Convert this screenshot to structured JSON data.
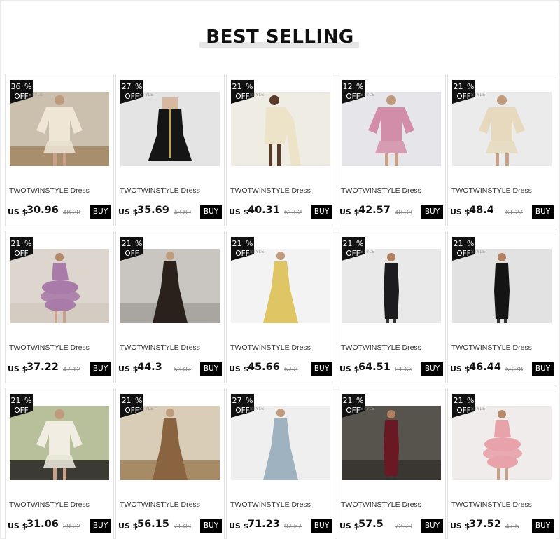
{
  "section_title": "BEST SELLING",
  "store_tag": "STYLE",
  "colors": {
    "badge": "#111111",
    "buy_button": "#000000",
    "accent_bar": "#e6e6e6"
  },
  "products": [
    {
      "discount": "36 %",
      "off": "OFF",
      "name": "TWOTWINSTYLE Dress",
      "currency": "US $",
      "price": "30.96",
      "original_price": "48.38",
      "buy": "BUY"
    },
    {
      "discount": "27 %",
      "off": "OFF",
      "name": "TWOTWINSTYLE Dress",
      "currency": "US $",
      "price": "35.69",
      "original_price": "48.89",
      "buy": "BUY"
    },
    {
      "discount": "21 %",
      "off": "OFF",
      "name": "TWOTWINSTYLE Dress",
      "currency": "US $",
      "price": "40.31",
      "original_price": "51.02",
      "buy": "BUY"
    },
    {
      "discount": "12 %",
      "off": "OFF",
      "name": "TWOTWINSTYLE Dress",
      "currency": "US $",
      "price": "42.57",
      "original_price": "48.38",
      "buy": "BUY"
    },
    {
      "discount": "21 %",
      "off": "OFF",
      "name": "TWOTWINSTYLE Dress",
      "currency": "US $",
      "price": "48.4",
      "original_price": "61.27",
      "buy": "BUY"
    },
    {
      "discount": "21 %",
      "off": "OFF",
      "name": "TWOTWINSTYLE Dress",
      "currency": "US $",
      "price": "37.22",
      "original_price": "47.12",
      "buy": "BUY"
    },
    {
      "discount": "21 %",
      "off": "OFF",
      "name": "TWOTWINSTYLE Dress",
      "currency": "US $",
      "price": "44.3",
      "original_price": "56.07",
      "buy": "BUY"
    },
    {
      "discount": "21 %",
      "off": "OFF",
      "name": "TWOTWINSTYLE Dress",
      "currency": "US $",
      "price": "45.66",
      "original_price": "57.8",
      "buy": "BUY"
    },
    {
      "discount": "21 %",
      "off": "OFF",
      "name": "TWOTWINSTYLE Dress",
      "currency": "US $",
      "price": "64.51",
      "original_price": "81.66",
      "buy": "BUY"
    },
    {
      "discount": "21 %",
      "off": "OFF",
      "name": "TWOTWINSTYLE Dress",
      "currency": "US $",
      "price": "46.44",
      "original_price": "58.78",
      "buy": "BUY"
    },
    {
      "discount": "21 %",
      "off": "OFF",
      "name": "TWOTWINSTYLE Dress",
      "currency": "US $",
      "price": "31.06",
      "original_price": "39.32",
      "buy": "BUY"
    },
    {
      "discount": "21 %",
      "off": "OFF",
      "name": "TWOTWINSTYLE Dress",
      "currency": "US $",
      "price": "56.15",
      "original_price": "71.08",
      "buy": "BUY"
    },
    {
      "discount": "27 %",
      "off": "OFF",
      "name": "TWOTWINSTYLE Dress",
      "currency": "US $",
      "price": "71.23",
      "original_price": "97.57",
      "buy": "BUY"
    },
    {
      "discount": "21 %",
      "off": "OFF",
      "name": "TWOTWINSTYLE Dress",
      "currency": "US $",
      "price": "57.5",
      "original_price": "72.79",
      "buy": "BUY"
    },
    {
      "discount": "21 %",
      "off": "OFF",
      "name": "TWOTWINSTYLE Dress",
      "currency": "US $",
      "price": "37.52",
      "original_price": "47.5",
      "buy": "BUY"
    }
  ]
}
